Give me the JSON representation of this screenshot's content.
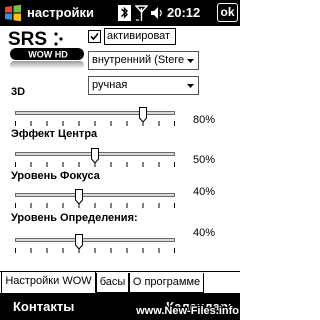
{
  "titlebar": {
    "app_title": "настройки",
    "time": "20:12",
    "ok_label": "ok",
    "icons": [
      "windows-logo-icon",
      "bluetooth-icon",
      "signal-icon",
      "speaker-icon"
    ]
  },
  "logo": {
    "brand": "SRS",
    "product": "WOW HD"
  },
  "enable": {
    "label": "активироват",
    "checked": true
  },
  "output_select": {
    "value": "внутренний (Stereo"
  },
  "mode_select": {
    "value": "ручная"
  },
  "sliders": [
    {
      "label": "3D",
      "value": 80,
      "display": "80%"
    },
    {
      "label": "Эффект Центра",
      "value": 50,
      "display": "50%"
    },
    {
      "label": "Уровень Фокуса",
      "value": 40,
      "display": "40%"
    },
    {
      "label": "Уровень Определения:",
      "value": 40,
      "display": "40%"
    }
  ],
  "tabs": [
    {
      "label": "Настройки WOW",
      "active": true
    },
    {
      "label": "басы",
      "active": false
    },
    {
      "label": "О программе",
      "active": false
    }
  ],
  "softkeys": {
    "left": "Контакты",
    "right": "Календарь"
  },
  "watermark": "www.New-Files.info",
  "colors": {
    "bar_background": "#000000",
    "bar_text": "#ffffff",
    "page_background": "#ffffff"
  }
}
